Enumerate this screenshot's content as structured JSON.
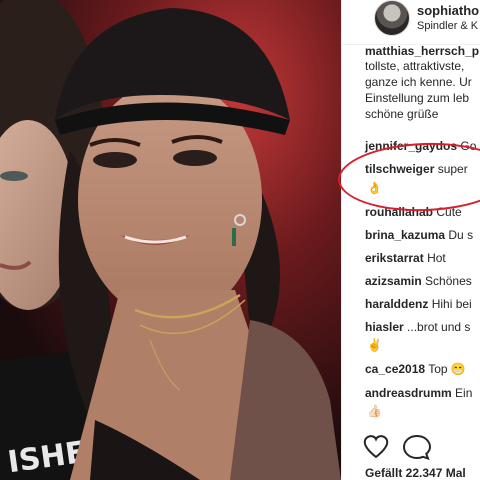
{
  "post": {
    "username": "sophiathor",
    "location": "Spindler & K",
    "partial_user": "matthias_herrsch_p",
    "caption_lines": [
      "tollste, attraktivste,",
      "ganze ich kenne. Ur",
      "Einstellung zum leb",
      "schöne grüße"
    ],
    "likes_label": "Gefällt 22.347 Mal"
  },
  "comments": [
    {
      "user": "jennifer_gaydos",
      "text": "Go"
    },
    {
      "user": "tilschweiger",
      "text": "super",
      "emoji": "👌"
    },
    {
      "user": "rouhallahab",
      "text": "Cute"
    },
    {
      "user": "brina_kazuma",
      "text": "Du s"
    },
    {
      "user": "erikstarrat",
      "text": "Hot"
    },
    {
      "user": "azizsamin",
      "text": "Schönes"
    },
    {
      "user": "haralddenz",
      "text": "Hihi bei"
    },
    {
      "user": "hiasler",
      "text": "...brot und s",
      "emoji": "✌️"
    },
    {
      "user": "ca_ce2018",
      "text": "Top 😁"
    },
    {
      "user": "andreasdrumm",
      "text": "Ein",
      "emoji": "👍🏻"
    }
  ],
  "icons": {
    "like": "heart-icon",
    "comment": "comment-bubble-icon",
    "avatar": "profile-avatar"
  },
  "highlight_color": "#d81e2c"
}
